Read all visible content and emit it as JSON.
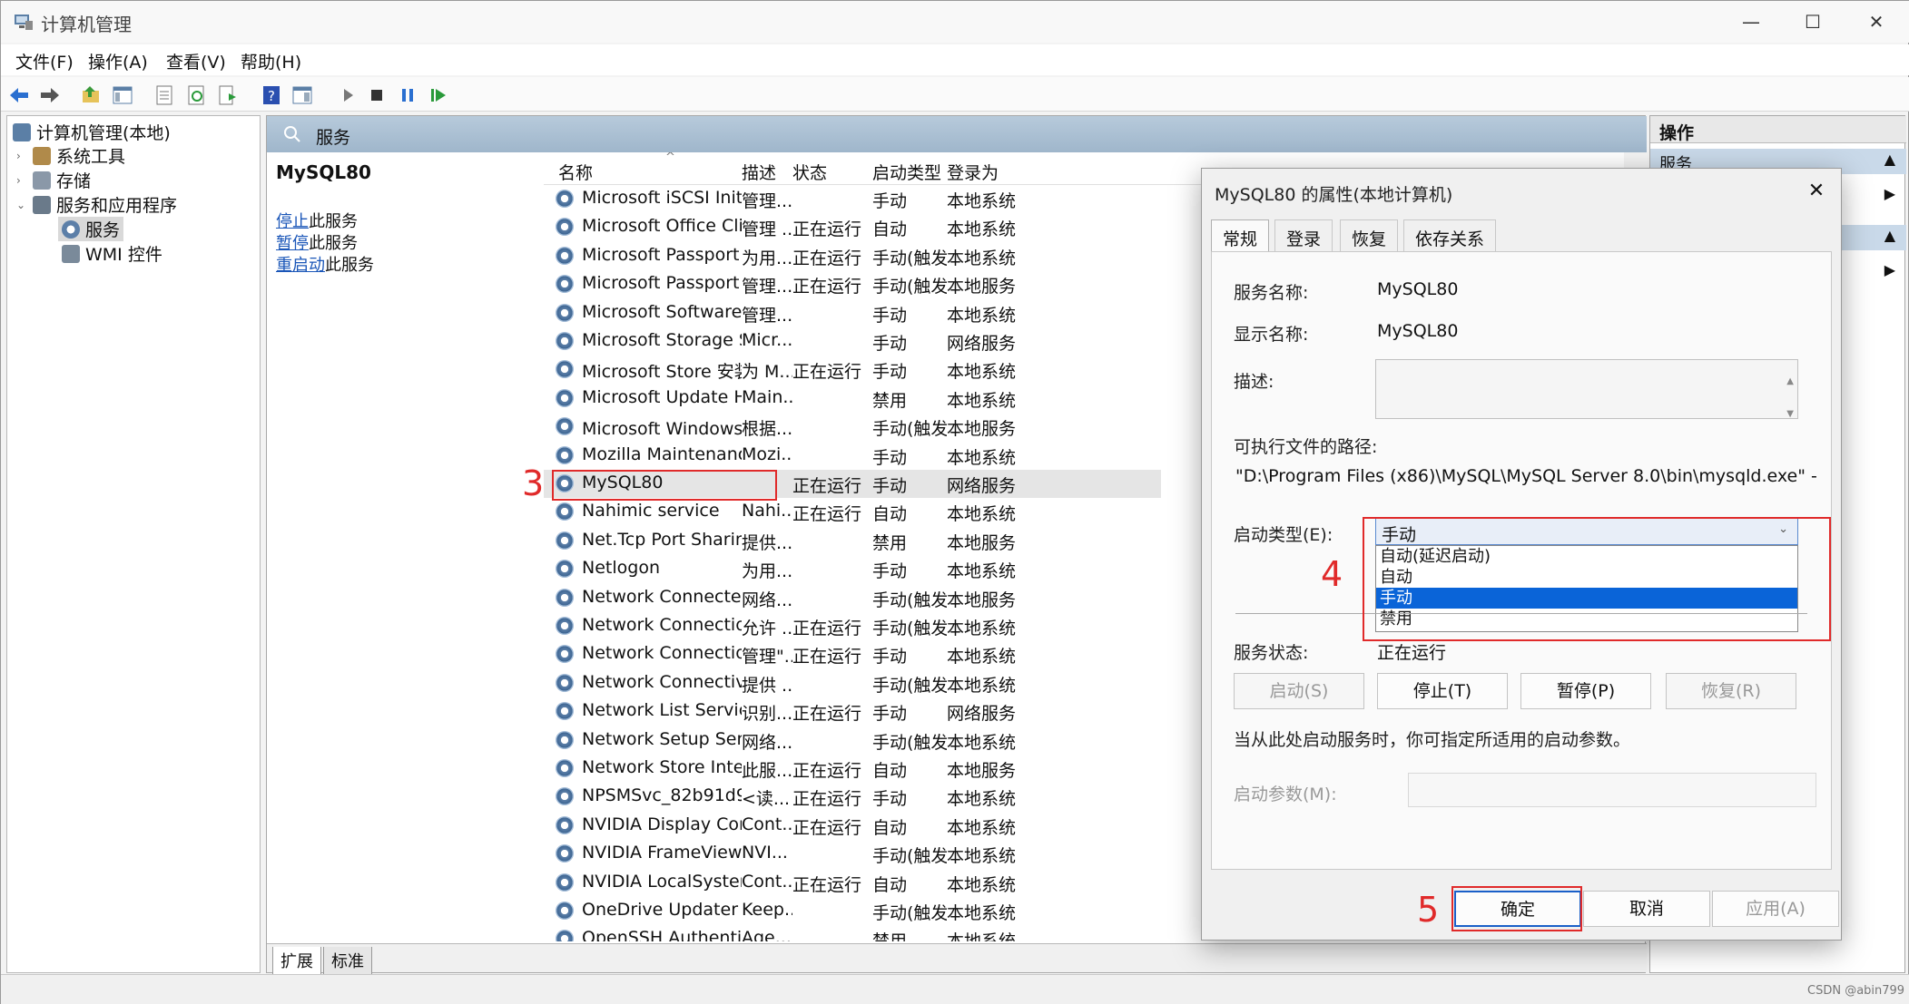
{
  "window": {
    "title": "计算机管理",
    "min": "—",
    "max": "☐",
    "close": "✕"
  },
  "menu": [
    "文件(F)",
    "操作(A)",
    "查看(V)",
    "帮助(H)"
  ],
  "tree": {
    "root": "计算机管理(本地)",
    "items": [
      {
        "label": "系统工具",
        "twisty": "›"
      },
      {
        "label": "存储",
        "twisty": "›"
      },
      {
        "label": "服务和应用程序",
        "twisty": "⌄"
      },
      {
        "label": "服务",
        "twisty": ""
      },
      {
        "label": "WMI 控件",
        "twisty": ""
      }
    ]
  },
  "mid": {
    "header": "服务",
    "selected_service": "MySQL80",
    "links": [
      {
        "link": "停止",
        "rest": "此服务"
      },
      {
        "link": "暂停",
        "rest": "此服务"
      },
      {
        "link": "重启动",
        "rest": "此服务"
      }
    ],
    "columns": [
      "名称",
      "描述",
      "状态",
      "启动类型",
      "登录为"
    ],
    "sort_indicator": "^",
    "rows": [
      [
        "Microsoft iSCSI Initiator Ser...",
        "管理...",
        "",
        "手动",
        "本地系统"
      ],
      [
        "Microsoft Office Click-to-R...",
        "管理 ...",
        "正在运行",
        "自动",
        "本地系统"
      ],
      [
        "Microsoft Passport",
        "为用...",
        "正在运行",
        "手动(触发...",
        "本地系统"
      ],
      [
        "Microsoft Passport Container",
        "管理...",
        "正在运行",
        "手动(触发...",
        "本地服务"
      ],
      [
        "Microsoft Software Shado...",
        "管理...",
        "",
        "手动",
        "本地系统"
      ],
      [
        "Microsoft Storage Spaces S...",
        "Micr...",
        "",
        "手动",
        "网络服务"
      ],
      [
        "Microsoft Store 安装服务",
        "为 M...",
        "正在运行",
        "手动",
        "本地系统"
      ],
      [
        "Microsoft Update Health S...",
        "Main...",
        "",
        "禁用",
        "本地系统"
      ],
      [
        "Microsoft Windows SMS 路...",
        "根据...",
        "",
        "手动(触发...",
        "本地服务"
      ],
      [
        "Mozilla Maintenance Service",
        "Mozi...",
        "",
        "手动",
        "本地系统"
      ],
      [
        "MySQL80",
        "",
        "正在运行",
        "手动",
        "网络服务"
      ],
      [
        "Nahimic service",
        "Nahi...",
        "正在运行",
        "自动",
        "本地系统"
      ],
      [
        "Net.Tcp Port Sharing Service",
        "提供...",
        "",
        "禁用",
        "本地服务"
      ],
      [
        "Netlogon",
        "为用...",
        "",
        "手动",
        "本地系统"
      ],
      [
        "Network Connected Devic...",
        "网络...",
        "",
        "手动(触发...",
        "本地服务"
      ],
      [
        "Network Connection Broker",
        "允许 ...",
        "正在运行",
        "手动(触发...",
        "本地系统"
      ],
      [
        "Network Connections",
        "管理\"...",
        "正在运行",
        "手动",
        "本地系统"
      ],
      [
        "Network Connectivity Assis...",
        "提供 ...",
        "",
        "手动(触发...",
        "本地系统"
      ],
      [
        "Network List Service",
        "识别...",
        "正在运行",
        "手动",
        "网络服务"
      ],
      [
        "Network Setup Service",
        "网络...",
        "",
        "手动(触发...",
        "本地系统"
      ],
      [
        "Network Store Interface Se...",
        "此服...",
        "正在运行",
        "自动",
        "本地服务"
      ],
      [
        "NPSMSvc_82b91d9",
        "<读...",
        "正在运行",
        "手动",
        "本地系统"
      ],
      [
        "NVIDIA Display Container LS",
        "Cont...",
        "正在运行",
        "自动",
        "本地系统"
      ],
      [
        "NVIDIA FrameView SDK se...",
        "NVI...",
        "",
        "手动(触发...",
        "本地系统"
      ],
      [
        "NVIDIA LocalSystem Conta...",
        "Cont...",
        "正在运行",
        "自动",
        "本地系统"
      ],
      [
        "OneDrive Updater Service",
        "Keep...",
        "",
        "手动(触发...",
        "本地系统"
      ],
      [
        "OpenSSH Authentication ...",
        "Age...",
        "",
        "禁用",
        "本地系统"
      ]
    ],
    "tabs": [
      "扩展",
      "标准"
    ]
  },
  "right": {
    "title": "操作",
    "band1": "服务"
  },
  "dialog": {
    "title": "MySQL80 的属性(本地计算机)",
    "tabs": [
      "常规",
      "登录",
      "恢复",
      "依存关系"
    ],
    "svc_name_label": "服务名称:",
    "svc_name": "MySQL80",
    "display_name_label": "显示名称:",
    "display_name": "MySQL80",
    "desc_label": "描述:",
    "path_label": "可执行文件的路径:",
    "path": "\"D:\\Program Files (x86)\\MySQL\\MySQL Server 8.0\\bin\\mysqld.exe\" --defaul",
    "startup_label": "启动类型(E):",
    "startup_value": "手动",
    "startup_options": [
      "自动(延迟启动)",
      "自动",
      "手动",
      "禁用"
    ],
    "selected_option": "手动",
    "status_label": "服务状态:",
    "status_value": "正在运行",
    "buttons": {
      "start": "启动(S)",
      "stop": "停止(T)",
      "pause": "暂停(P)",
      "resume": "恢复(R)"
    },
    "hint": "当从此处启动服务时，你可指定所适用的启动参数。",
    "param_label": "启动参数(M):",
    "ok": "确定",
    "cancel": "取消",
    "apply": "应用(A)"
  },
  "annotations": {
    "step3": "3",
    "step4": "4",
    "step5": "5",
    "color": "#e02a2a"
  },
  "watermark": "CSDN @abin799"
}
